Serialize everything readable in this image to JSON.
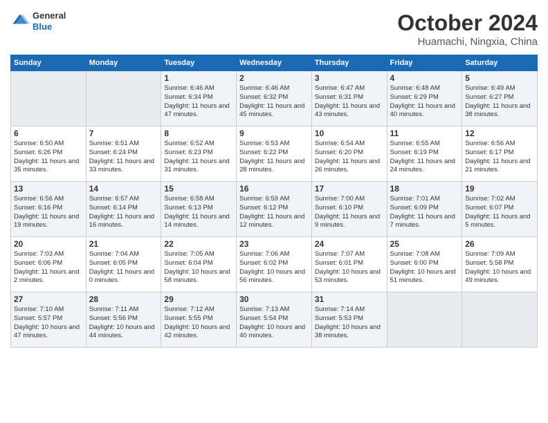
{
  "logo": {
    "general": "General",
    "blue": "Blue"
  },
  "header": {
    "month": "October 2024",
    "location": "Huamachi, Ningxia, China"
  },
  "weekdays": [
    "Sunday",
    "Monday",
    "Tuesday",
    "Wednesday",
    "Thursday",
    "Friday",
    "Saturday"
  ],
  "weeks": [
    [
      {
        "day": "",
        "empty": true
      },
      {
        "day": "",
        "empty": true
      },
      {
        "day": "1",
        "sunrise": "Sunrise: 6:46 AM",
        "sunset": "Sunset: 6:34 PM",
        "daylight": "Daylight: 11 hours and 47 minutes."
      },
      {
        "day": "2",
        "sunrise": "Sunrise: 6:46 AM",
        "sunset": "Sunset: 6:32 PM",
        "daylight": "Daylight: 11 hours and 45 minutes."
      },
      {
        "day": "3",
        "sunrise": "Sunrise: 6:47 AM",
        "sunset": "Sunset: 6:31 PM",
        "daylight": "Daylight: 11 hours and 43 minutes."
      },
      {
        "day": "4",
        "sunrise": "Sunrise: 6:48 AM",
        "sunset": "Sunset: 6:29 PM",
        "daylight": "Daylight: 11 hours and 40 minutes."
      },
      {
        "day": "5",
        "sunrise": "Sunrise: 6:49 AM",
        "sunset": "Sunset: 6:27 PM",
        "daylight": "Daylight: 11 hours and 38 minutes."
      }
    ],
    [
      {
        "day": "6",
        "sunrise": "Sunrise: 6:50 AM",
        "sunset": "Sunset: 6:26 PM",
        "daylight": "Daylight: 11 hours and 35 minutes."
      },
      {
        "day": "7",
        "sunrise": "Sunrise: 6:51 AM",
        "sunset": "Sunset: 6:24 PM",
        "daylight": "Daylight: 11 hours and 33 minutes."
      },
      {
        "day": "8",
        "sunrise": "Sunrise: 6:52 AM",
        "sunset": "Sunset: 6:23 PM",
        "daylight": "Daylight: 11 hours and 31 minutes."
      },
      {
        "day": "9",
        "sunrise": "Sunrise: 6:53 AM",
        "sunset": "Sunset: 6:22 PM",
        "daylight": "Daylight: 11 hours and 28 minutes."
      },
      {
        "day": "10",
        "sunrise": "Sunrise: 6:54 AM",
        "sunset": "Sunset: 6:20 PM",
        "daylight": "Daylight: 11 hours and 26 minutes."
      },
      {
        "day": "11",
        "sunrise": "Sunrise: 6:55 AM",
        "sunset": "Sunset: 6:19 PM",
        "daylight": "Daylight: 11 hours and 24 minutes."
      },
      {
        "day": "12",
        "sunrise": "Sunrise: 6:56 AM",
        "sunset": "Sunset: 6:17 PM",
        "daylight": "Daylight: 11 hours and 21 minutes."
      }
    ],
    [
      {
        "day": "13",
        "sunrise": "Sunrise: 6:56 AM",
        "sunset": "Sunset: 6:16 PM",
        "daylight": "Daylight: 11 hours and 19 minutes."
      },
      {
        "day": "14",
        "sunrise": "Sunrise: 6:57 AM",
        "sunset": "Sunset: 6:14 PM",
        "daylight": "Daylight: 11 hours and 16 minutes."
      },
      {
        "day": "15",
        "sunrise": "Sunrise: 6:58 AM",
        "sunset": "Sunset: 6:13 PM",
        "daylight": "Daylight: 11 hours and 14 minutes."
      },
      {
        "day": "16",
        "sunrise": "Sunrise: 6:59 AM",
        "sunset": "Sunset: 6:12 PM",
        "daylight": "Daylight: 11 hours and 12 minutes."
      },
      {
        "day": "17",
        "sunrise": "Sunrise: 7:00 AM",
        "sunset": "Sunset: 6:10 PM",
        "daylight": "Daylight: 11 hours and 9 minutes."
      },
      {
        "day": "18",
        "sunrise": "Sunrise: 7:01 AM",
        "sunset": "Sunset: 6:09 PM",
        "daylight": "Daylight: 11 hours and 7 minutes."
      },
      {
        "day": "19",
        "sunrise": "Sunrise: 7:02 AM",
        "sunset": "Sunset: 6:07 PM",
        "daylight": "Daylight: 11 hours and 5 minutes."
      }
    ],
    [
      {
        "day": "20",
        "sunrise": "Sunrise: 7:03 AM",
        "sunset": "Sunset: 6:06 PM",
        "daylight": "Daylight: 11 hours and 2 minutes."
      },
      {
        "day": "21",
        "sunrise": "Sunrise: 7:04 AM",
        "sunset": "Sunset: 6:05 PM",
        "daylight": "Daylight: 11 hours and 0 minutes."
      },
      {
        "day": "22",
        "sunrise": "Sunrise: 7:05 AM",
        "sunset": "Sunset: 6:04 PM",
        "daylight": "Daylight: 10 hours and 58 minutes."
      },
      {
        "day": "23",
        "sunrise": "Sunrise: 7:06 AM",
        "sunset": "Sunset: 6:02 PM",
        "daylight": "Daylight: 10 hours and 56 minutes."
      },
      {
        "day": "24",
        "sunrise": "Sunrise: 7:07 AM",
        "sunset": "Sunset: 6:01 PM",
        "daylight": "Daylight: 10 hours and 53 minutes."
      },
      {
        "day": "25",
        "sunrise": "Sunrise: 7:08 AM",
        "sunset": "Sunset: 6:00 PM",
        "daylight": "Daylight: 10 hours and 51 minutes."
      },
      {
        "day": "26",
        "sunrise": "Sunrise: 7:09 AM",
        "sunset": "Sunset: 5:58 PM",
        "daylight": "Daylight: 10 hours and 49 minutes."
      }
    ],
    [
      {
        "day": "27",
        "sunrise": "Sunrise: 7:10 AM",
        "sunset": "Sunset: 5:57 PM",
        "daylight": "Daylight: 10 hours and 47 minutes."
      },
      {
        "day": "28",
        "sunrise": "Sunrise: 7:11 AM",
        "sunset": "Sunset: 5:56 PM",
        "daylight": "Daylight: 10 hours and 44 minutes."
      },
      {
        "day": "29",
        "sunrise": "Sunrise: 7:12 AM",
        "sunset": "Sunset: 5:55 PM",
        "daylight": "Daylight: 10 hours and 42 minutes."
      },
      {
        "day": "30",
        "sunrise": "Sunrise: 7:13 AM",
        "sunset": "Sunset: 5:54 PM",
        "daylight": "Daylight: 10 hours and 40 minutes."
      },
      {
        "day": "31",
        "sunrise": "Sunrise: 7:14 AM",
        "sunset": "Sunset: 5:53 PM",
        "daylight": "Daylight: 10 hours and 38 minutes."
      },
      {
        "day": "",
        "empty": true
      },
      {
        "day": "",
        "empty": true
      }
    ]
  ]
}
